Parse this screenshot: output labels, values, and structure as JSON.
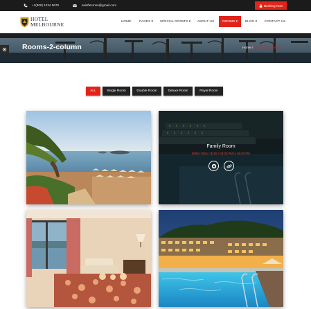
{
  "topbar": {
    "phone": "+1(800) 1234 5678",
    "email": "asiaftecmos@gmail.com",
    "booking_label": "Booking Now",
    "phone_icon": "phone-icon",
    "email_icon": "envelope-icon",
    "booking_icon": "lock-icon"
  },
  "header": {
    "logo_line1": "HOTEL",
    "logo_line2": "MELBOURNE",
    "nav": [
      {
        "label": "HOME",
        "active": false
      },
      {
        "label": "PAGES ▾",
        "active": false
      },
      {
        "label": "SPECIAL ROOM'S ▾",
        "active": false
      },
      {
        "label": "ABOUT US",
        "active": false
      },
      {
        "label": "ROOMS ▾",
        "active": true
      },
      {
        "label": "BLOG ▾",
        "active": false
      },
      {
        "label": "CONTACT US",
        "active": false
      }
    ]
  },
  "banner": {
    "title": "Rooms-2-column",
    "breadcrumb_home": "Home",
    "breadcrumb_sep": "/",
    "breadcrumb_current": "Rooms-2-column",
    "settings_icon": "gear-icon"
  },
  "filters": [
    {
      "label": "ALL",
      "active": true
    },
    {
      "label": "Single Room",
      "active": false
    },
    {
      "label": "Double Room",
      "active": false
    },
    {
      "label": "Deluxe Room",
      "active": false
    },
    {
      "label": "Royal Room",
      "active": false
    }
  ],
  "rooms": {
    "featured": {
      "name": "Family Room",
      "meta": "$089 / $081 / $105 / 06:00 PM to 06:00 PM",
      "view_icon": "eye-icon",
      "link_icon": "link-icon"
    }
  },
  "colors": {
    "accent": "#e2231a",
    "topbar_bg": "#1b1b1b",
    "header_bg": "#ffffff",
    "text_dark": "#1f2a36"
  }
}
